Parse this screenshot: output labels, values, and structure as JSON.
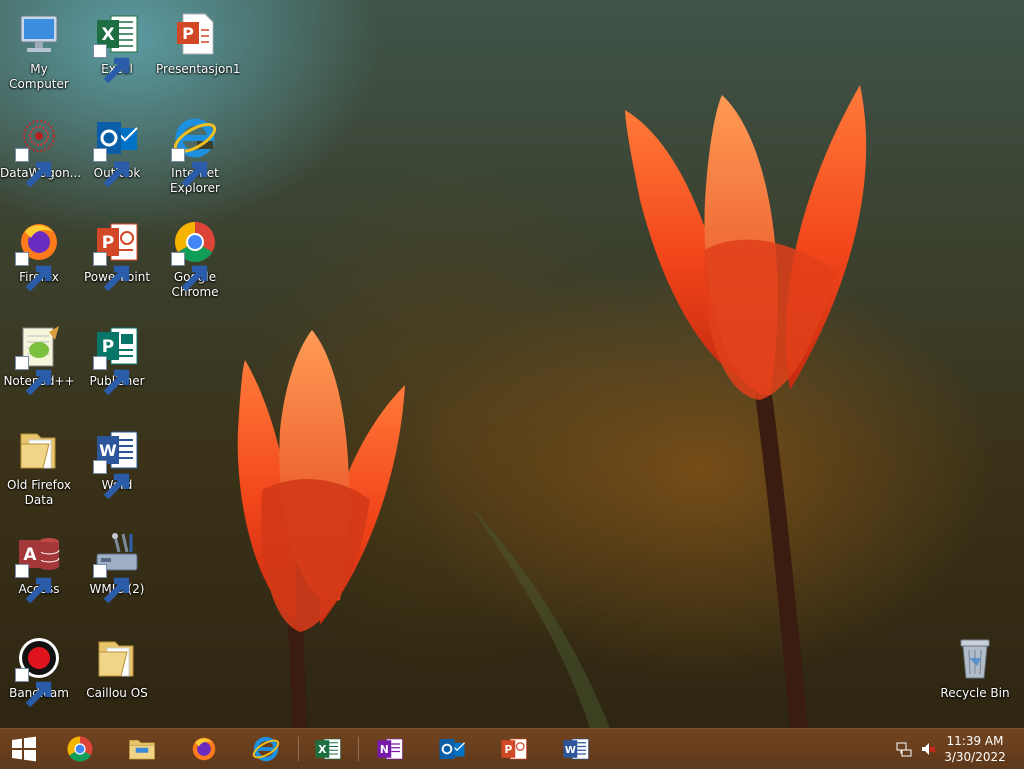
{
  "desktop": {
    "icons": [
      {
        "label": "My Computer",
        "icon": "computer-icon"
      },
      {
        "label": "Excel",
        "icon": "excel-icon"
      },
      {
        "label": "Presentasjon1",
        "icon": "powerpoint-document-icon"
      },
      {
        "label": "DataWagon...",
        "icon": "datawagon-icon"
      },
      {
        "label": "Outlook",
        "icon": "outlook-icon"
      },
      {
        "label": "Internet Explorer",
        "icon": "internet-explorer-icon"
      },
      {
        "label": "Firefox",
        "icon": "firefox-icon"
      },
      {
        "label": "PowerPoint",
        "icon": "powerpoint-icon"
      },
      {
        "label": "Google Chrome",
        "icon": "chrome-icon"
      },
      {
        "label": "Notepad++",
        "icon": "notepadpp-icon"
      },
      {
        "label": "Publisher",
        "icon": "publisher-icon"
      },
      {
        "label": "Old Firefox Data",
        "icon": "folder-icon"
      },
      {
        "label": "Word",
        "icon": "word-icon"
      },
      {
        "label": "Access",
        "icon": "access-icon"
      },
      {
        "label": "WMIC (2)",
        "icon": "wmic-icon"
      },
      {
        "label": "Bandicam",
        "icon": "bandicam-icon"
      },
      {
        "label": "Caillou OS",
        "icon": "folder-icon"
      },
      {
        "label": "Recycle Bin",
        "icon": "recycle-bin-icon"
      }
    ]
  },
  "taskbar": {
    "buttons": [
      {
        "name": "start-button",
        "icon": "windows-logo-icon"
      },
      {
        "name": "chrome",
        "icon": "chrome-icon"
      },
      {
        "name": "file-explorer",
        "icon": "file-explorer-icon"
      },
      {
        "name": "firefox",
        "icon": "firefox-icon"
      },
      {
        "name": "internet-explorer",
        "icon": "internet-explorer-icon"
      },
      {
        "name": "excel",
        "icon": "excel-icon"
      },
      {
        "name": "onenote",
        "icon": "onenote-icon"
      },
      {
        "name": "outlook",
        "icon": "outlook-icon"
      },
      {
        "name": "powerpoint",
        "icon": "powerpoint-icon"
      },
      {
        "name": "word",
        "icon": "word-icon"
      }
    ],
    "tray": {
      "network_icon": "network-icon",
      "volume_icon": "volume-muted-icon",
      "time": "11:39 AM",
      "date": "3/30/2022"
    }
  },
  "colors": {
    "excel": "#1d6f42",
    "word": "#2b579a",
    "powerpoint": "#d24726",
    "outlook": "#0072c6",
    "onenote": "#7719aa",
    "publisher": "#077568",
    "access": "#a4373a"
  }
}
